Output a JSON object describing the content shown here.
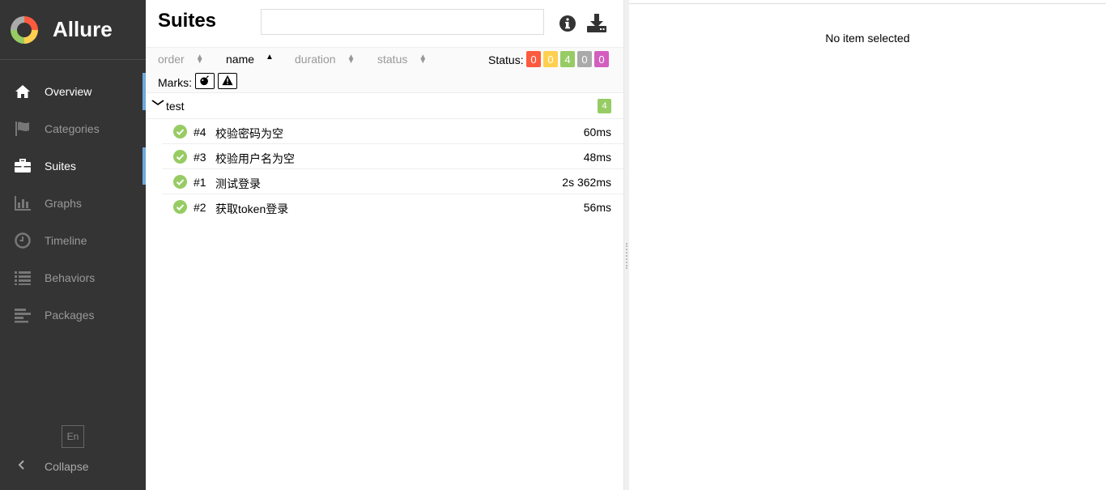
{
  "brand": {
    "title": "Allure"
  },
  "nav": [
    {
      "label": "Overview",
      "icon": "home-icon"
    },
    {
      "label": "Categories",
      "icon": "flag-icon"
    },
    {
      "label": "Suites",
      "icon": "briefcase-icon"
    },
    {
      "label": "Graphs",
      "icon": "bar-chart-icon"
    },
    {
      "label": "Timeline",
      "icon": "clock-icon"
    },
    {
      "label": "Behaviors",
      "icon": "list-icon"
    },
    {
      "label": "Packages",
      "icon": "align-left-icon"
    }
  ],
  "language": "En",
  "collapse_label": "Collapse",
  "pane": {
    "title": "Suites",
    "search_value": "",
    "sort": {
      "order": "order",
      "name": "name",
      "duration": "duration",
      "status": "status"
    },
    "status_label": "Status:",
    "counts": [
      {
        "value": "0",
        "color": "#fd5a3e"
      },
      {
        "value": "0",
        "color": "#ffd050"
      },
      {
        "value": "4",
        "color": "#97cc64"
      },
      {
        "value": "0",
        "color": "#aaaaaa"
      },
      {
        "value": "0",
        "color": "#d35ebe"
      }
    ],
    "marks_label": "Marks:",
    "group": {
      "name": "test",
      "count": "4"
    },
    "rows": [
      {
        "num": "#4",
        "name": "校验密码为空",
        "duration": "60ms"
      },
      {
        "num": "#3",
        "name": "校验用户名为空",
        "duration": "48ms"
      },
      {
        "num": "#1",
        "name": "测试登录",
        "duration": "2s 362ms"
      },
      {
        "num": "#2",
        "name": "获取token登录",
        "duration": "56ms"
      }
    ]
  },
  "right": {
    "empty_text": "No item selected"
  }
}
